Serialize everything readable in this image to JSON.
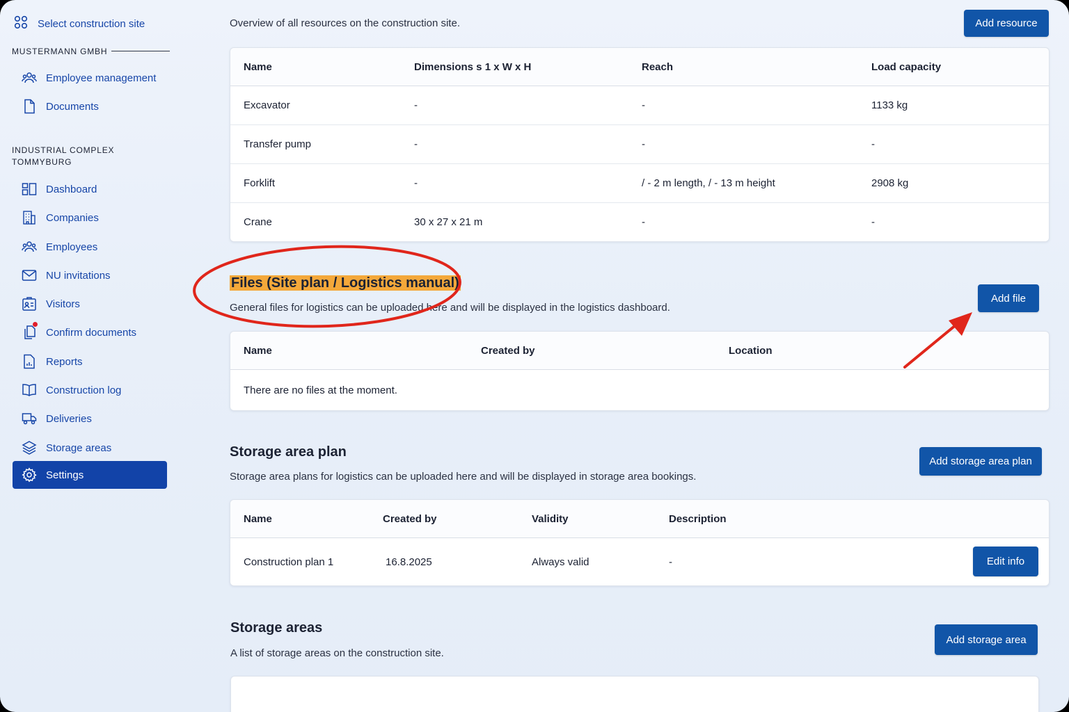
{
  "sidebar": {
    "select_site": "Select construction site",
    "company": "MUSTERMANN GMBH",
    "company_items": [
      {
        "label": "Employee management",
        "icon": "users-icon"
      },
      {
        "label": "Documents",
        "icon": "document-icon"
      }
    ],
    "project_line1": "INDUSTRIAL COMPLEX",
    "project_line2": "TOMMYBURG",
    "project_items": [
      {
        "label": "Dashboard",
        "icon": "dashboard-icon"
      },
      {
        "label": "Companies",
        "icon": "building-icon"
      },
      {
        "label": "Employees",
        "icon": "users-icon"
      },
      {
        "label": "NU invitations",
        "icon": "mail-icon"
      },
      {
        "label": "Visitors",
        "icon": "id-card-icon"
      },
      {
        "label": "Confirm documents",
        "icon": "documents-copy-icon"
      },
      {
        "label": "Reports",
        "icon": "report-icon"
      },
      {
        "label": "Construction log",
        "icon": "book-icon"
      },
      {
        "label": "Deliveries",
        "icon": "truck-icon"
      },
      {
        "label": "Storage areas",
        "icon": "layers-icon"
      },
      {
        "label": "Settings",
        "icon": "gear-icon",
        "active": true
      }
    ]
  },
  "resources": {
    "description": "Overview of all resources on the construction site.",
    "add_button": "Add resource",
    "columns": [
      "Name",
      "Dimensions s 1 x W x H",
      "Reach",
      "Load capacity"
    ],
    "rows": [
      [
        "Excavator",
        "-",
        "-",
        "1133 kg"
      ],
      [
        "Transfer pump",
        "-",
        "-",
        "-"
      ],
      [
        "Forklift",
        "-",
        "/ - 2 m length, / - 13 m height",
        "2908 kg"
      ],
      [
        "Crane",
        "30 x 27 x 21 m",
        "-",
        "-"
      ]
    ]
  },
  "files": {
    "title": "Files (Site plan / Logistics manual)",
    "description": "General files for logistics can be uploaded here and will be displayed in the logistics dashboard.",
    "add_button": "Add file",
    "columns": [
      "Name",
      "Created by",
      "Location"
    ],
    "empty": "There are no files at the moment."
  },
  "storage_plan": {
    "title": "Storage area plan",
    "description": "Storage area plans for logistics can be uploaded here and will be displayed in storage area bookings.",
    "add_button": "Add storage area plan",
    "columns": [
      "Name",
      "Created by",
      "Validity",
      "Description"
    ],
    "rows": [
      {
        "name": "Construction plan 1",
        "created_by": "16.8.2025",
        "validity": "Always valid",
        "description": "-",
        "action": "Edit info"
      }
    ]
  },
  "storage_areas": {
    "title": "Storage areas",
    "description": "A list of storage areas on the construction site.",
    "add_button": "Add storage area"
  },
  "colors": {
    "accent": "#1155a8",
    "nav_text": "#1746a8",
    "active_nav": "#1243a8",
    "highlight": "#f4a83a",
    "annotation": "#e0261b"
  }
}
